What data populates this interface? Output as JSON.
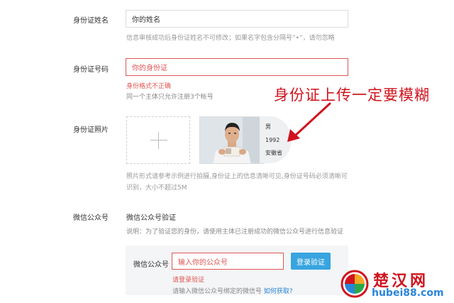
{
  "id_name": {
    "label": "身份证姓名",
    "placeholder": "你的姓名",
    "hint": "信息审核成功后身份证姓名不可修改；如果名字包含分隔号“•”，请勿忽略"
  },
  "id_number": {
    "label": "身份证号码",
    "placeholder": "你的身份证",
    "error": "身份格式不正确",
    "hint": "同一个主体只允许注册3个帐号"
  },
  "id_photo": {
    "label": "身份证照片",
    "hint_line1": "照片形式请参考示例进行拍摄,身份证上的信息清晰可见,身份证号码必须清晰可",
    "hint_line2": "识别，大小不超过5M",
    "card_text": {
      "gender": "男",
      "year": "1992",
      "address": "安徽省"
    }
  },
  "annotation": "身份证上传一定要模糊",
  "wechat": {
    "label": "微信公众号",
    "title": "微信公众号验证",
    "description": "说明：为了验证您的身份，请使用主体已注册成功的微信公众号进行信息验证",
    "field_label": "微信公众号",
    "placeholder": "输入你的公众号",
    "button": "登录验证",
    "error": "请登录验证",
    "help_text": "请输入微信公众号绑定的微信号",
    "help_link": "如何获取?"
  },
  "watermark": {
    "brand": "楚汉网",
    "domain": "hubei88.com"
  },
  "colors": {
    "error": "#e05454",
    "button": "#38a4e0",
    "annotation": "#d0141e",
    "link": "#2a86d8"
  }
}
